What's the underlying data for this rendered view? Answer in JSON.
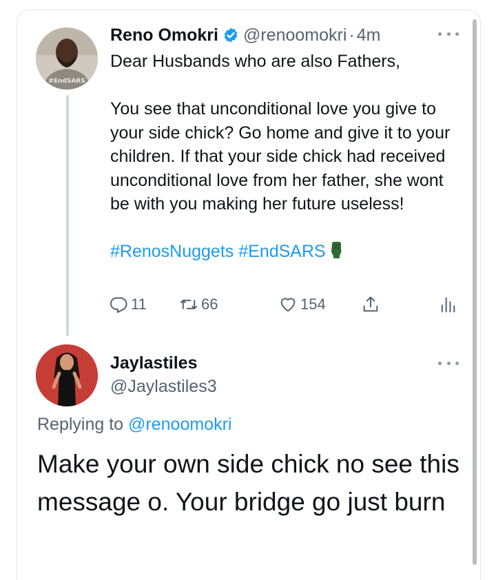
{
  "tweet": {
    "author": {
      "display_name": "Reno Omokri",
      "handle": "@renoomokri",
      "verified": true,
      "avatar_shirt_text": "#EndSARS"
    },
    "separator": "·",
    "time": "4m",
    "text_lines": {
      "greeting": "Dear Husbands who are also Fathers,",
      "paragraph": "You see that unconditional love you give to your side chick? Go home and give it to your children. If that your side chick had received unconditional love from her father, she wont be with you making her future useless!"
    },
    "hashtags": [
      "#RenosNuggets",
      "#EndSARS"
    ],
    "actions": {
      "replies": "11",
      "retweets": "66",
      "likes": "154"
    }
  },
  "reply": {
    "author": {
      "display_name": "Jaylastiles",
      "handle": "@Jaylastiles3"
    },
    "replying_prefix": "Replying to",
    "replying_to": "@renoomokri",
    "text": "Make your own side chick no see this message o. Your bridge go just burn"
  },
  "colors": {
    "link": "#1d9bf0",
    "secondary_text": "#536471",
    "primary_text": "#0f1419",
    "thread_line": "#cfd9de"
  }
}
